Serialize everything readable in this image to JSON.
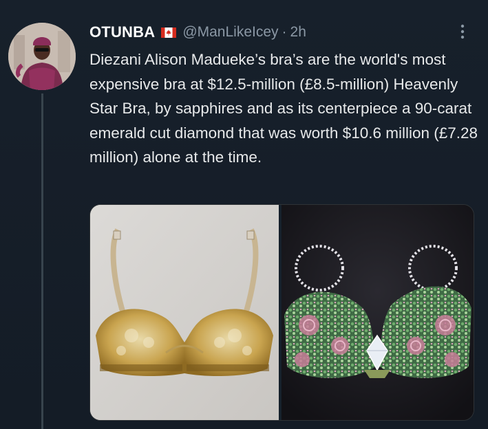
{
  "tweet": {
    "display_name": "OTUNBA",
    "handle": "@ManLikeIcey",
    "separator": "·",
    "time": "2h",
    "text": "Diezani Alison Madueke’s bra’s are the world's most expensive bra at $12.5-million (£8.5-million) Heavenly Star Bra, by sapphires and as its centerpiece a 90-carat emerald cut diamond that was worth $10.6 million (£7.28 million) alone at the time."
  },
  "icons": {
    "flag": "canada-flag-icon",
    "more": "more-options-icon"
  },
  "colors": {
    "background": "#15202b",
    "text": "#e7e9ea",
    "secondary": "#8b98a5",
    "divider": "#38444d"
  }
}
